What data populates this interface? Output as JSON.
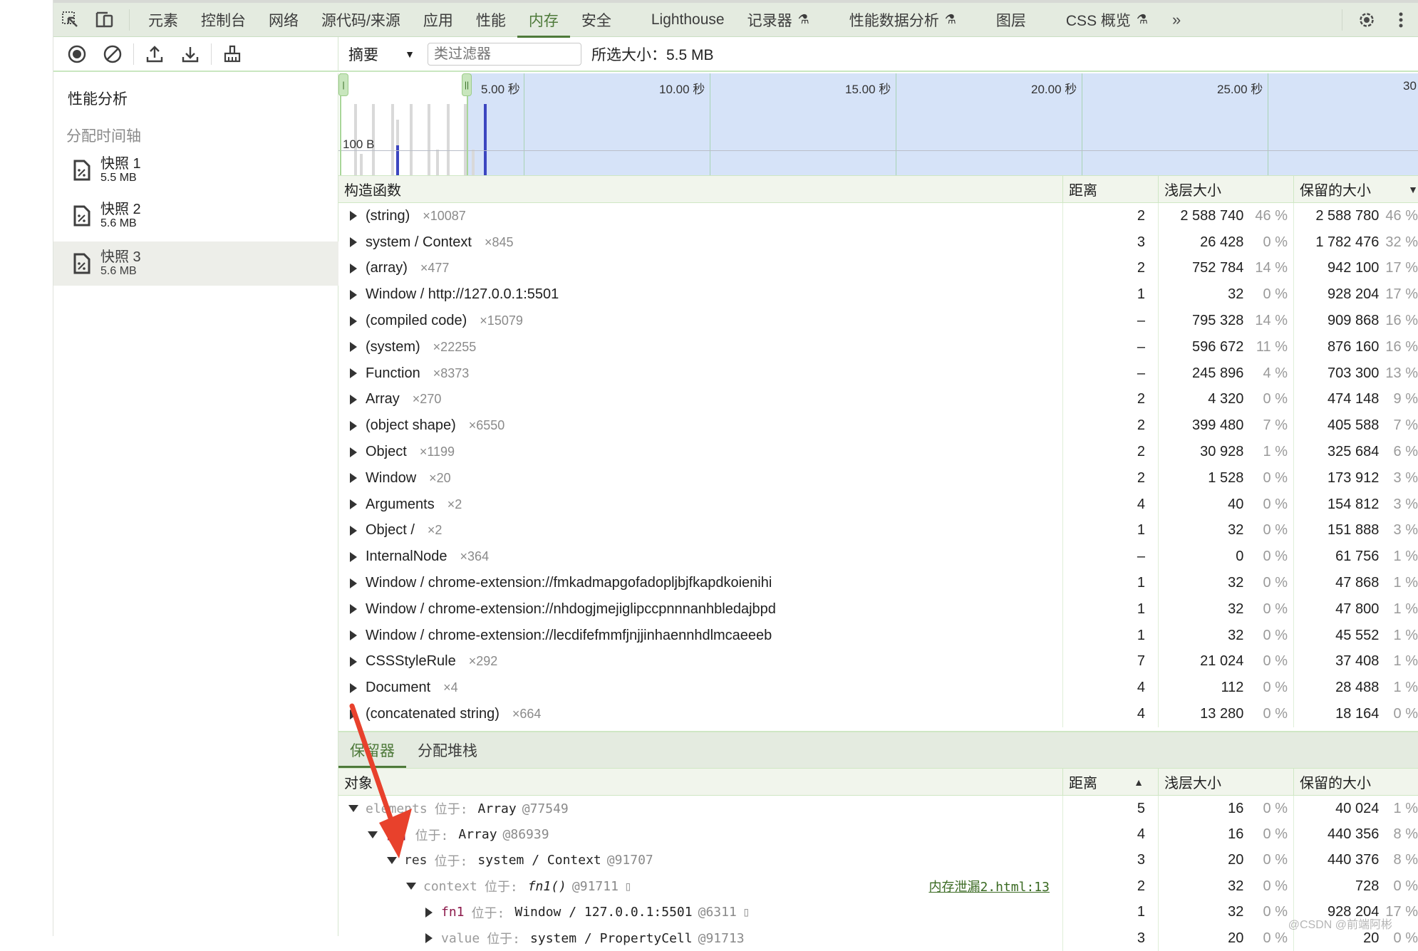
{
  "tabs": {
    "items": [
      {
        "label": "元素",
        "active": false
      },
      {
        "label": "控制台",
        "active": false
      },
      {
        "label": "网络",
        "active": false
      },
      {
        "label": "源代码/来源",
        "active": false
      },
      {
        "label": "应用",
        "active": false
      },
      {
        "label": "性能",
        "active": false
      },
      {
        "label": "内存",
        "active": true
      },
      {
        "label": "安全",
        "active": false
      },
      {
        "label": "Lighthouse",
        "active": false
      },
      {
        "label": "记录器",
        "active": false,
        "experimental": true
      },
      {
        "label": "性能数据分析",
        "active": false,
        "experimental": true
      },
      {
        "label": "图层",
        "active": false
      },
      {
        "label": "CSS 概览",
        "active": false,
        "experimental": true
      }
    ],
    "more_label": "»",
    "icons": [
      "inspect-element-icon",
      "device-toolbar-icon",
      "settings-gear-icon",
      "more-vertical-icon"
    ]
  },
  "toolbar": {
    "icons": [
      "record-icon",
      "clear-icon",
      "upload-icon",
      "download-icon",
      "collect-garbage-icon"
    ],
    "view_select": "摘要",
    "filter_placeholder": "类过滤器",
    "selected_size": "所选大小：5.5 MB"
  },
  "sidebar": {
    "title": "性能分析",
    "section": "分配时间轴",
    "snapshots": [
      {
        "name": "快照 1",
        "size": "5.5 MB",
        "selected": false
      },
      {
        "name": "快照 2",
        "size": "5.6 MB",
        "selected": false
      },
      {
        "name": "快照 3",
        "size": "5.6 MB",
        "selected": true
      }
    ]
  },
  "timeline": {
    "scale_label": "100 B",
    "ticks": [
      "5.00 秒",
      "10.00 秒",
      "15.00 秒",
      "20.00 秒",
      "25.00 秒",
      "30"
    ]
  },
  "constructors": {
    "headers": {
      "name": "构造函数",
      "distance": "距离",
      "shallow": "浅层大小",
      "retained": "保留的大小"
    },
    "rows": [
      {
        "name": "(string)",
        "count": "×10087",
        "distance": "2",
        "shallow": "2 588 740",
        "shallow_pct": "46 %",
        "retained": "2 588 780",
        "retained_pct": "46 %"
      },
      {
        "name": "system / Context",
        "count": "×845",
        "distance": "3",
        "shallow": "26 428",
        "shallow_pct": "0 %",
        "retained": "1 782 476",
        "retained_pct": "32 %"
      },
      {
        "name": "(array)",
        "count": "×477",
        "distance": "2",
        "shallow": "752 784",
        "shallow_pct": "14 %",
        "retained": "942 100",
        "retained_pct": "17 %"
      },
      {
        "name": "Window / http://127.0.0.1:5501",
        "count": "",
        "distance": "1",
        "shallow": "32",
        "shallow_pct": "0 %",
        "retained": "928 204",
        "retained_pct": "17 %"
      },
      {
        "name": "(compiled code)",
        "count": "×15079",
        "distance": "–",
        "shallow": "795 328",
        "shallow_pct": "14 %",
        "retained": "909 868",
        "retained_pct": "16 %"
      },
      {
        "name": "(system)",
        "count": "×22255",
        "distance": "–",
        "shallow": "596 672",
        "shallow_pct": "11 %",
        "retained": "876 160",
        "retained_pct": "16 %"
      },
      {
        "name": "Function",
        "count": "×8373",
        "distance": "–",
        "shallow": "245 896",
        "shallow_pct": "4 %",
        "retained": "703 300",
        "retained_pct": "13 %"
      },
      {
        "name": "Array",
        "count": "×270",
        "distance": "2",
        "shallow": "4 320",
        "shallow_pct": "0 %",
        "retained": "474 148",
        "retained_pct": "9 %"
      },
      {
        "name": "(object shape)",
        "count": "×6550",
        "distance": "2",
        "shallow": "399 480",
        "shallow_pct": "7 %",
        "retained": "405 588",
        "retained_pct": "7 %"
      },
      {
        "name": "Object",
        "count": "×1199",
        "distance": "2",
        "shallow": "30 928",
        "shallow_pct": "1 %",
        "retained": "325 684",
        "retained_pct": "6 %"
      },
      {
        "name": "Window",
        "count": "×20",
        "distance": "2",
        "shallow": "1 528",
        "shallow_pct": "0 %",
        "retained": "173 912",
        "retained_pct": "3 %"
      },
      {
        "name": "Arguments",
        "count": "×2",
        "distance": "4",
        "shallow": "40",
        "shallow_pct": "0 %",
        "retained": "154 812",
        "retained_pct": "3 %"
      },
      {
        "name": "Object /",
        "count": "×2",
        "distance": "1",
        "shallow": "32",
        "shallow_pct": "0 %",
        "retained": "151 888",
        "retained_pct": "3 %"
      },
      {
        "name": "InternalNode",
        "count": "×364",
        "distance": "–",
        "shallow": "0",
        "shallow_pct": "0 %",
        "retained": "61 756",
        "retained_pct": "1 %"
      },
      {
        "name": "Window / chrome-extension://fmkadmapgofadopljbjfkapdkoienihi",
        "count": "",
        "distance": "1",
        "shallow": "32",
        "shallow_pct": "0 %",
        "retained": "47 868",
        "retained_pct": "1 %"
      },
      {
        "name": "Window / chrome-extension://nhdogjmejiglipccpnnnanhbledajbpd",
        "count": "",
        "distance": "1",
        "shallow": "32",
        "shallow_pct": "0 %",
        "retained": "47 800",
        "retained_pct": "1 %"
      },
      {
        "name": "Window / chrome-extension://lecdifefmmfjnjjinhaennhdlmcaeeeb",
        "count": "",
        "distance": "1",
        "shallow": "32",
        "shallow_pct": "0 %",
        "retained": "45 552",
        "retained_pct": "1 %"
      },
      {
        "name": "CSSStyleRule",
        "count": "×292",
        "distance": "7",
        "shallow": "21 024",
        "shallow_pct": "0 %",
        "retained": "37 408",
        "retained_pct": "1 %"
      },
      {
        "name": "Document",
        "count": "×4",
        "distance": "4",
        "shallow": "112",
        "shallow_pct": "0 %",
        "retained": "28 488",
        "retained_pct": "1 %"
      },
      {
        "name": "(concatenated string)",
        "count": "×664",
        "distance": "4",
        "shallow": "13 280",
        "shallow_pct": "0 %",
        "retained": "18 164",
        "retained_pct": "0 %"
      }
    ]
  },
  "bottom_tabs": [
    {
      "label": "保留器",
      "active": true
    },
    {
      "label": "分配堆栈",
      "active": false
    }
  ],
  "retainers": {
    "headers": {
      "name": "对象",
      "distance": "距离",
      "shallow": "浅层大小",
      "retained": "保留的大小"
    },
    "rows": [
      {
        "indent": 0,
        "expanded": true,
        "name": "elements",
        "name_style": "grey",
        "loc": "位于:",
        "obj": "Array",
        "id": "@77549",
        "box": "",
        "link": "",
        "distance": "5",
        "shallow": "16",
        "shallow_pct": "0 %",
        "retained": "40 024",
        "retained_pct": "1 %"
      },
      {
        "indent": 1,
        "expanded": true,
        "name": "[1]",
        "name_style": "red",
        "loc": "位于:",
        "obj": "Array",
        "id": "@86939",
        "box": "",
        "link": "",
        "distance": "4",
        "shallow": "16",
        "shallow_pct": "0 %",
        "retained": "440 356",
        "retained_pct": "8 %"
      },
      {
        "indent": 2,
        "expanded": true,
        "name": "res",
        "name_style": "strong",
        "loc": "位于:",
        "obj": "system / Context",
        "id": "@91707",
        "box": "",
        "link": "",
        "distance": "3",
        "shallow": "20",
        "shallow_pct": "0 %",
        "retained": "440 376",
        "retained_pct": "8 %"
      },
      {
        "indent": 3,
        "expanded": true,
        "name": "context",
        "name_style": "grey",
        "loc": "位于:",
        "obj": "fn1()",
        "obj_italic": true,
        "id": "@91711",
        "box": "▯",
        "link": "内存泄漏2.html:13",
        "distance": "2",
        "shallow": "32",
        "shallow_pct": "0 %",
        "retained": "728",
        "retained_pct": "0 %"
      },
      {
        "indent": 4,
        "expanded": false,
        "name": "fn1",
        "name_style": "red",
        "loc": "位于:",
        "obj": "Window / 127.0.0.1:5501",
        "id": "@6311",
        "box": "▯",
        "link": "",
        "distance": "1",
        "shallow": "32",
        "shallow_pct": "0 %",
        "retained": "928 204",
        "retained_pct": "17 %"
      },
      {
        "indent": 4,
        "expanded": false,
        "name": "value",
        "name_style": "grey",
        "loc": "位于:",
        "obj": "system / PropertyCell",
        "id": "@91713",
        "box": "",
        "link": "",
        "distance": "3",
        "shallow": "20",
        "shallow_pct": "0 %",
        "retained": "20",
        "retained_pct": "0 %"
      }
    ]
  },
  "watermark": "@CSDN @前端阿彬"
}
